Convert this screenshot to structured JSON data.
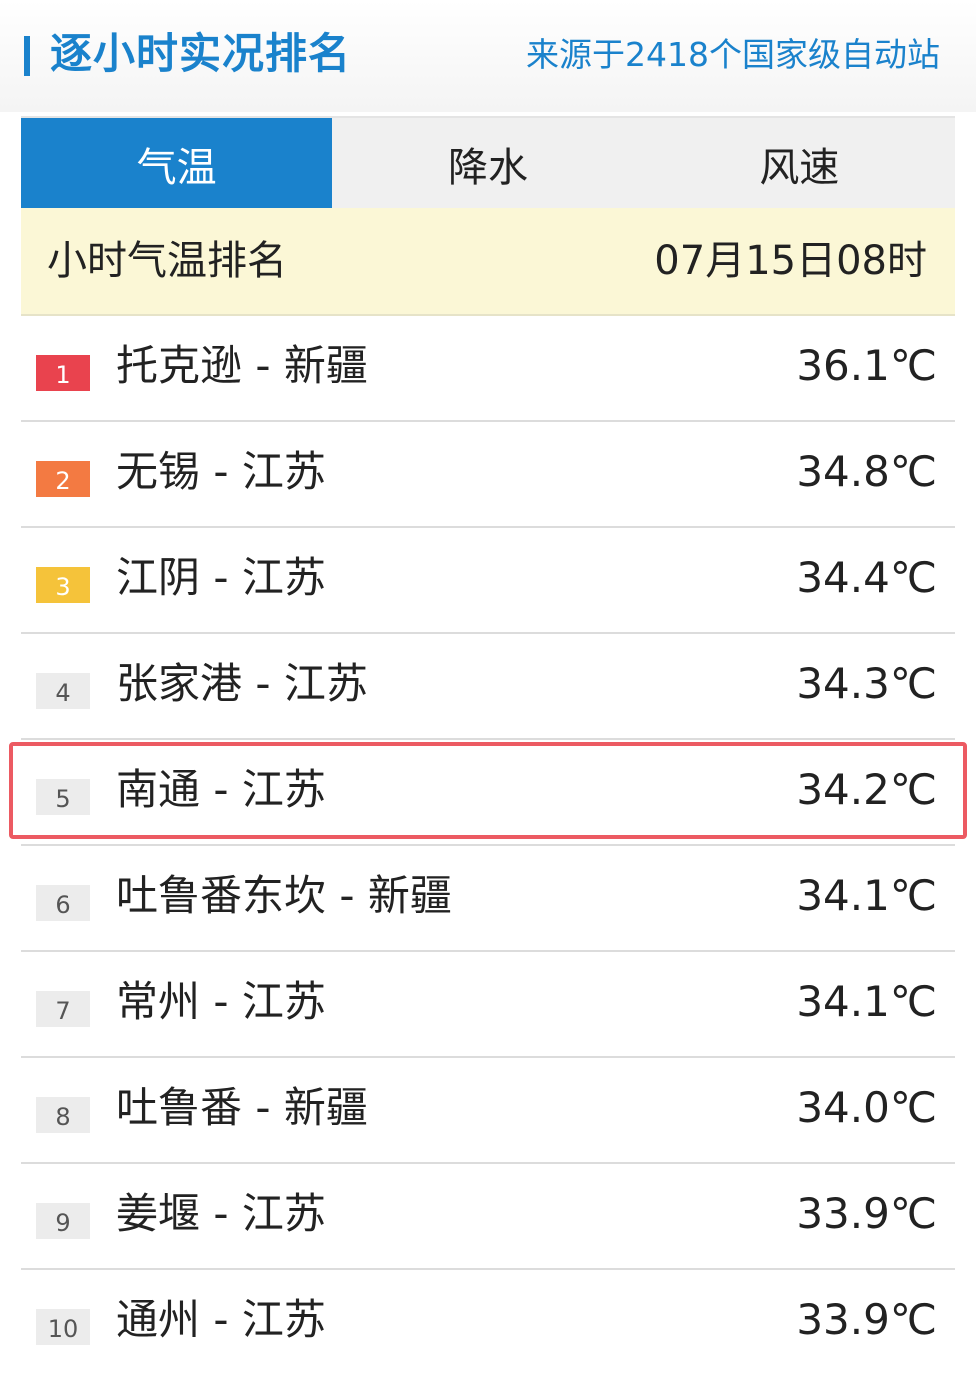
{
  "header": {
    "title": "逐小时实况排名",
    "source": "来源于2418个国家级自动站"
  },
  "tabs": [
    {
      "label": "气温",
      "active": true
    },
    {
      "label": "降水",
      "active": false
    },
    {
      "label": "风速",
      "active": false
    }
  ],
  "subheader": {
    "title": "小时气温排名",
    "time": "07月15日08时"
  },
  "rankings": [
    {
      "rank": "1",
      "station": "托克逊 - 新疆",
      "temp": "36.1℃"
    },
    {
      "rank": "2",
      "station": "无锡 - 江苏",
      "temp": "34.8℃"
    },
    {
      "rank": "3",
      "station": "江阴 - 江苏",
      "temp": "34.4℃"
    },
    {
      "rank": "4",
      "station": "张家港 - 江苏",
      "temp": "34.3℃"
    },
    {
      "rank": "5",
      "station": "南通 - 江苏",
      "temp": "34.2℃"
    },
    {
      "rank": "6",
      "station": "吐鲁番东坎 - 新疆",
      "temp": "34.1℃"
    },
    {
      "rank": "7",
      "station": "常州 - 江苏",
      "temp": "34.1℃"
    },
    {
      "rank": "8",
      "station": "吐鲁番 - 新疆",
      "temp": "34.0℃"
    },
    {
      "rank": "9",
      "station": "姜堰 - 江苏",
      "temp": "33.9℃"
    },
    {
      "rank": "10",
      "station": "通州 - 江苏",
      "temp": "33.9℃"
    }
  ],
  "colors": {
    "accent": "#1a82cc",
    "rank1": "#e9434e",
    "rank2": "#f37a42",
    "rank3": "#f5c33a",
    "highlight": "#ec5a62",
    "subheader_bg": "#fbf7d6"
  }
}
